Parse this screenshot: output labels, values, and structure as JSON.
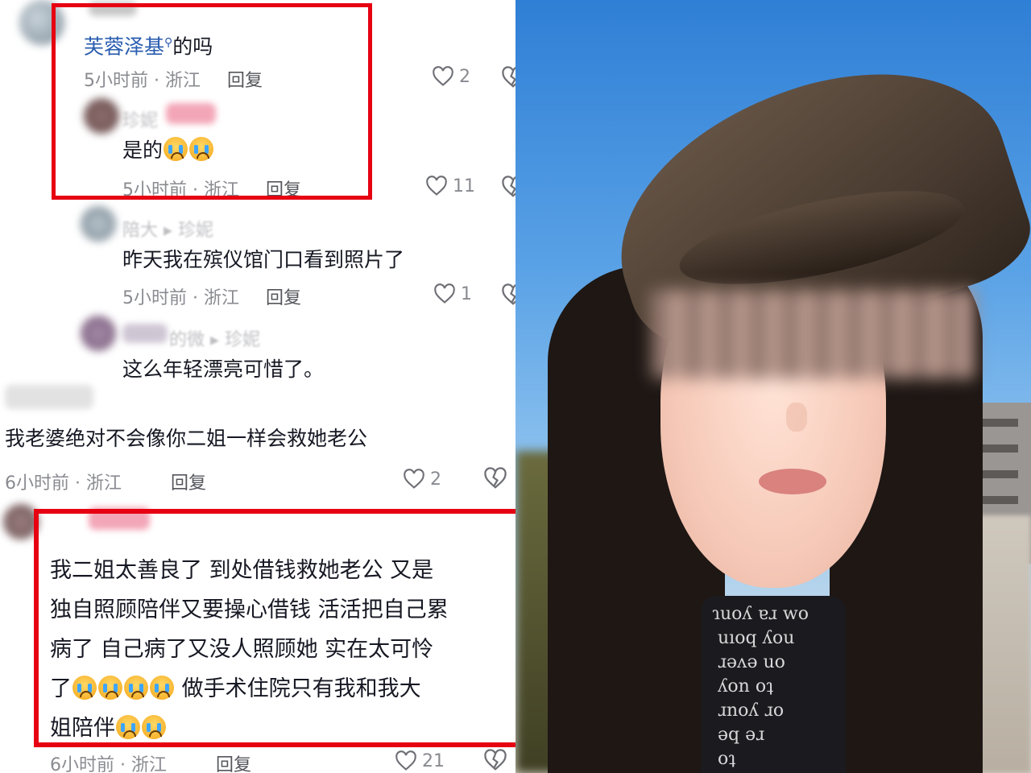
{
  "comments": [
    {
      "id": "c1",
      "mention": "芙蓉泽基",
      "text_suffix": "的吗",
      "time": "5小时前 · 浙江",
      "reply": "回复",
      "likes": "2"
    },
    {
      "id": "c2",
      "name_visible": "珍妮",
      "text": "是的",
      "time": "5小时前 · 浙江",
      "reply": "回复",
      "likes": "11"
    },
    {
      "id": "c3",
      "name_visible": "陪大 ▸ 珍妮",
      "text": "昨天我在殡仪馆门口看到照片了",
      "time": "5小时前 · 浙江",
      "reply": "回复",
      "likes": "1"
    },
    {
      "id": "c4",
      "name_visible": "的微 ▸ 珍妮",
      "text": "这么年轻漂亮可惜了。"
    },
    {
      "id": "c5",
      "text": "我老婆绝对不会像你二姐一样会救她老公",
      "time": "6小时前 · 浙江",
      "reply": "回复",
      "likes": "2"
    },
    {
      "id": "c6",
      "lines": [
        "我二姐太善良了  到处借钱救她老公  又是",
        "独自照顾陪伴又要操心借钱  活活把自己累",
        "病了  自己病了又没人照顾她  实在太可怜",
        "做手术住院只有我和我大",
        "姐陪伴"
      ],
      "line4_prefix": "了",
      "time": "6小时前 · 浙江",
      "reply": "回复",
      "likes": "21"
    }
  ],
  "photo": {
    "shirt_text": "ɿuoʎ ɐɹ wo\n uıoq ʎou \n ɹəʌə uo\n ʎon oʇ\n ɹnoʎ ɹo\n ǝq əɹ\n oʇ"
  },
  "colors": {
    "highlight_box": "#e60012",
    "mention": "#2a5db0"
  },
  "icons": [
    "heart-icon",
    "broken-heart-icon",
    "search-icon",
    "crying-emoji"
  ]
}
